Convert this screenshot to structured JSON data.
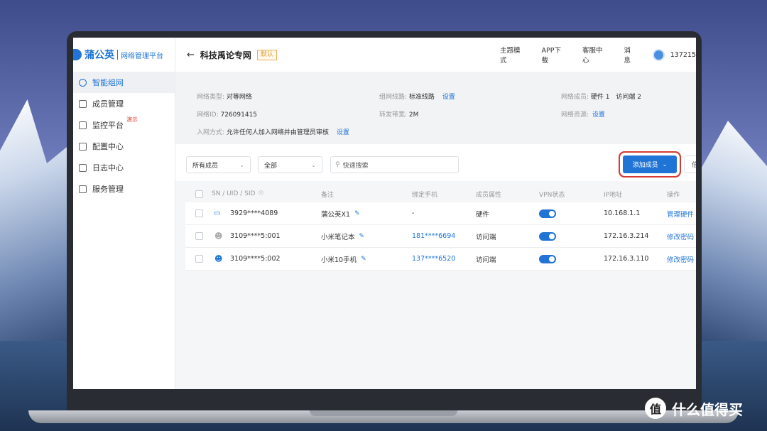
{
  "app": {
    "brand_name": "蒲公英",
    "brand_sub": "网络管理平台"
  },
  "sidebar": {
    "items": [
      {
        "label": "智能组网",
        "active": true
      },
      {
        "label": "成员管理"
      },
      {
        "label": "监控平台",
        "badge": "演示"
      },
      {
        "label": "配置中心"
      },
      {
        "label": "日志中心"
      },
      {
        "label": "服务管理"
      }
    ]
  },
  "topbar": {
    "back_icon": "←",
    "title": "科技禹论专网",
    "default_tag": "默认",
    "links": [
      "主题模式",
      "APP下载",
      "客服中心",
      "消息"
    ],
    "user": "137215"
  },
  "info": {
    "net_type_key": "网络类型:",
    "net_type_val": "对等网络",
    "net_id_key": "网络ID:",
    "net_id_val": "726091415",
    "join_key": "入网方式:",
    "join_val": "允许任何人加入网络并由管理员审核",
    "join_link": "设置",
    "route_key": "组网线路:",
    "route_val": "标准线路",
    "route_link": "设置",
    "bw_key": "转发带宽:",
    "bw_val": "2M",
    "members_key": "网络成员:",
    "members_hw": "硬件 1",
    "members_client": "访问端 2",
    "res_key": "网络资源:",
    "res_link": "设置"
  },
  "toolbar": {
    "filter_members": "所有成员",
    "filter_all": "全部",
    "search_placeholder": "快速搜索",
    "add_button": "添加成员",
    "extra_button": "倍"
  },
  "table": {
    "headers": [
      "SN / UID / SID",
      "备注",
      "绑定手机",
      "成员属性",
      "VPN状态",
      "IP地址",
      "操作"
    ],
    "rows": [
      {
        "id": "3929****4089",
        "note": "蒲公英X1",
        "phone": "-",
        "attr": "硬件",
        "vpn": "on",
        "ip": "10.168.1.1",
        "action": "管理硬件",
        "icon": "device-icon"
      },
      {
        "id": "3109****5:001",
        "note": "小米笔记本",
        "phone": "181****6694",
        "attr": "访问端",
        "vpn": "on",
        "ip": "172.16.3.214",
        "action": "修改密码",
        "icon": "user-icon"
      },
      {
        "id": "3109****5:002",
        "note": "小米10手机",
        "phone": "137****6520",
        "attr": "访问端",
        "vpn": "on",
        "ip": "172.16.3.110",
        "action": "修改密码",
        "icon": "user-icon"
      }
    ]
  },
  "watermark": {
    "glyph": "值",
    "text": "什么值得买"
  }
}
